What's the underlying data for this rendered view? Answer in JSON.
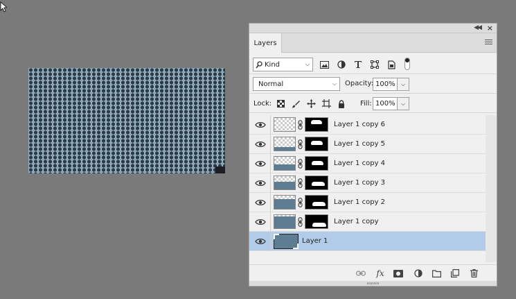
{
  "colors": {
    "workspace_bg": "#7a7a7a",
    "panel_bg": "#f0f0f0",
    "selected_layer_bg": "#b1cbe8",
    "layer_thumb_fill": "#5f7d92"
  },
  "panel": {
    "tab_title": "Layers",
    "filter": {
      "kind_label": "Kind",
      "icons": [
        "image-filter-icon",
        "adjustment-filter-icon",
        "type-filter-icon",
        "shape-filter-icon",
        "smart-object-filter-icon"
      ]
    },
    "blend": {
      "mode": "Normal",
      "opacity_label": "Opacity:",
      "opacity_value": "100%"
    },
    "lock": {
      "label": "Lock:",
      "icons": [
        "lock-transparent-pixels-icon",
        "lock-image-pixels-icon",
        "lock-position-icon",
        "lock-artboard-icon",
        "lock-all-icon"
      ],
      "fill_label": "Fill:",
      "fill_value": "100%"
    },
    "layers": [
      {
        "name": "Layer 1 copy 6",
        "visible": true,
        "has_mask": true,
        "thumb_fill": 0.0,
        "mask_level": 0.0
      },
      {
        "name": "Layer 1 copy 5",
        "visible": true,
        "has_mask": true,
        "thumb_fill": 0.2,
        "mask_level": 0.2
      },
      {
        "name": "Layer 1 copy 4",
        "visible": true,
        "has_mask": true,
        "thumb_fill": 0.4,
        "mask_level": 0.4
      },
      {
        "name": "Layer 1 copy 3",
        "visible": true,
        "has_mask": true,
        "thumb_fill": 0.6,
        "mask_level": 0.6
      },
      {
        "name": "Layer 1 copy 2",
        "visible": true,
        "has_mask": true,
        "thumb_fill": 0.8,
        "mask_level": 0.8
      },
      {
        "name": "Layer 1 copy",
        "visible": true,
        "has_mask": true,
        "thumb_fill": 1.0,
        "mask_level": 1.0
      },
      {
        "name": "Layer 1",
        "visible": true,
        "has_mask": false,
        "selected": true,
        "thumb_fill": 1.0
      }
    ],
    "footer_icons": [
      "link-layers-icon",
      "layer-style-fx-icon",
      "add-mask-icon",
      "new-adjustment-layer-icon",
      "new-group-folder-icon",
      "new-layer-icon",
      "delete-layer-trash-icon"
    ]
  }
}
